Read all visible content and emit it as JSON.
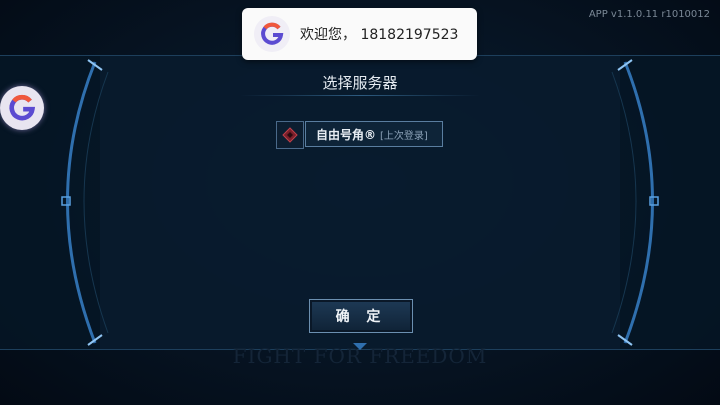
{
  "version": "APP v1.1.0.11 r1010012",
  "toast": {
    "message": "欢迎您，  18182197523",
    "logo_letter": "G"
  },
  "side_logo": {
    "letter": "G"
  },
  "dialog": {
    "title": "选择服务器"
  },
  "server": {
    "name": "自由号角®",
    "note": "[上次登录]"
  },
  "confirm_label": "确 定",
  "watermark": "FIGHT FOR FREEDOM",
  "colors": {
    "accent": "#3f8fd8",
    "frame": "#2a6fb0",
    "panel": "#0a1e32"
  }
}
